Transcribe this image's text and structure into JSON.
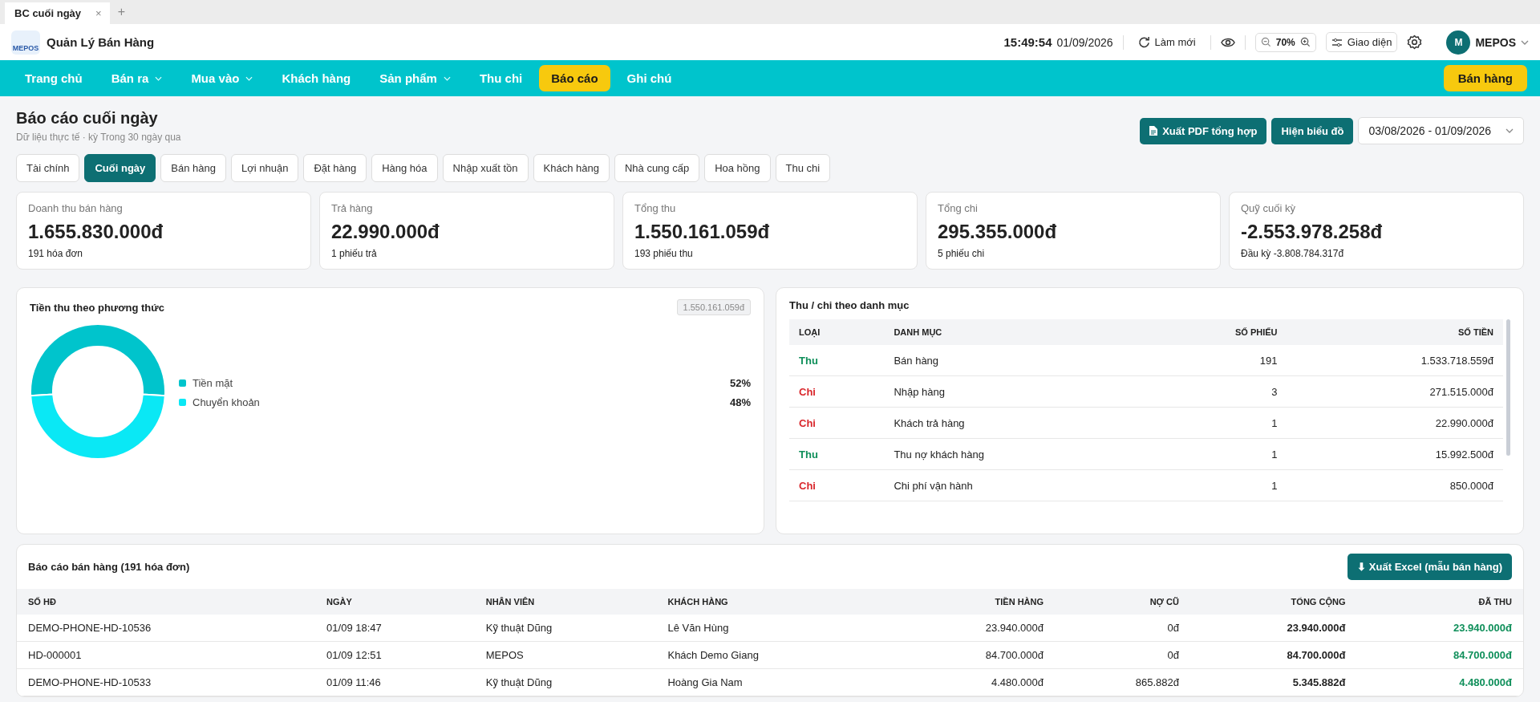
{
  "browser_tab": {
    "title": "BC cuối ngày",
    "close": "×",
    "new_tab": "+"
  },
  "header": {
    "app_name": "Quản Lý Bán Hàng",
    "logo_text": "MEPOS",
    "time": "15:49:54",
    "date": "01/09/2026",
    "refresh": "Làm mới",
    "zoom": "70%",
    "theme": "Giao diện",
    "avatar": "M",
    "user": "MEPOS"
  },
  "nav": {
    "items": [
      {
        "label": "Trang chủ",
        "has_menu": false,
        "selected": false
      },
      {
        "label": "Bán ra",
        "has_menu": true,
        "selected": false
      },
      {
        "label": "Mua vào",
        "has_menu": true,
        "selected": false
      },
      {
        "label": "Khách hàng",
        "has_menu": false,
        "selected": false
      },
      {
        "label": "Sản phẩm",
        "has_menu": true,
        "selected": false
      },
      {
        "label": "Thu chi",
        "has_menu": false,
        "selected": false
      },
      {
        "label": "Báo cáo",
        "has_menu": false,
        "selected": true
      },
      {
        "label": "Ghi chú",
        "has_menu": false,
        "selected": false
      }
    ],
    "sell_button": "Bán hàng"
  },
  "page": {
    "title": "Báo cáo cuối ngày",
    "subtitle": "Dữ liệu thực tế · kỳ Trong 30 ngày qua",
    "export_pdf": "Xuất PDF tổng hợp",
    "show_chart": "Hiện biểu đồ",
    "date_range": "03/08/2026 - 01/09/2026"
  },
  "report_tabs": [
    {
      "label": "Tài chính",
      "selected": false
    },
    {
      "label": "Cuối ngày",
      "selected": true
    },
    {
      "label": "Bán hàng",
      "selected": false
    },
    {
      "label": "Lợi nhuận",
      "selected": false
    },
    {
      "label": "Đặt hàng",
      "selected": false
    },
    {
      "label": "Hàng hóa",
      "selected": false
    },
    {
      "label": "Nhập xuất tồn",
      "selected": false
    },
    {
      "label": "Khách hàng",
      "selected": false
    },
    {
      "label": "Nhà cung cấp",
      "selected": false
    },
    {
      "label": "Hoa hồng",
      "selected": false
    },
    {
      "label": "Thu chi",
      "selected": false
    }
  ],
  "summary_cards": [
    {
      "label": "Doanh thu bán hàng",
      "value": "1.655.830.000đ",
      "note": "191 hóa đơn"
    },
    {
      "label": "Trả hàng",
      "value": "22.990.000đ",
      "note": "1 phiếu trả"
    },
    {
      "label": "Tổng thu",
      "value": "1.550.161.059đ",
      "note": "193 phiếu thu"
    },
    {
      "label": "Tổng chi",
      "value": "295.355.000đ",
      "note": "5 phiếu chi"
    },
    {
      "label": "Quỹ cuối kỳ",
      "value": "-2.553.978.258đ",
      "note": "Đầu kỳ -3.808.784.317đ"
    }
  ],
  "payment_panel": {
    "title": "Tiền thu theo phương thức",
    "total": "1.550.161.059đ",
    "legend": [
      {
        "percent": "52%",
        "color": "#00c4cc"
      },
      {
        "percent": "48%",
        "color": "#0ae8f5"
      }
    ],
    "chart_data": {
      "type": "donut",
      "categories": [
        "Tiền mặt",
        "Chuyển khoản"
      ],
      "values": [
        52,
        48
      ]
    }
  },
  "category_panel": {
    "title": "Thu / chi theo danh mục",
    "columns": [
      "LOẠI",
      "DANH MỤC",
      "SỐ PHIẾU",
      "SỐ TIỀN"
    ],
    "rows": [
      {
        "kind": "thu",
        "type": "Thu",
        "category": "Bán hàng",
        "count": "191",
        "amount": "1.533.718.559đ"
      },
      {
        "kind": "chi",
        "type": "Chi",
        "category": "Nhập hàng",
        "count": "3",
        "amount": "271.515.000đ"
      },
      {
        "kind": "chi",
        "type": "Chi",
        "category": "Khách trả hàng",
        "count": "1",
        "amount": "22.990.000đ"
      },
      {
        "kind": "thu",
        "type": "Thu",
        "category": "Thu nợ khách hàng",
        "count": "1",
        "amount": "15.992.500đ"
      },
      {
        "kind": "chi",
        "type": "Chi",
        "category": "Chi phí vận hành",
        "count": "1",
        "amount": "850.000đ"
      }
    ]
  },
  "sales_panel": {
    "title": "Báo cáo bán hàng (191 hóa đơn)",
    "export_excel": "⬇ Xuất Excel (mẫu bán hàng)",
    "columns": [
      "SỐ HĐ",
      "NGÀY",
      "NHÂN VIÊN",
      "KHÁCH HÀNG",
      "TIỀN HÀNG",
      "NỢ CŨ",
      "TỔNG CỘNG",
      "ĐÃ THU"
    ],
    "rows": [
      [
        "DEMO-PHONE-HD-10536",
        "01/09 18:47",
        "Kỹ thuật Dũng",
        "Lê Văn Hùng",
        "23.940.000đ",
        "0đ",
        "23.940.000đ",
        "23.940.000đ"
      ],
      [
        "HD-000001",
        "01/09 12:51",
        "MEPOS",
        "Khách Demo Giang",
        "84.700.000đ",
        "0đ",
        "84.700.000đ",
        "84.700.000đ"
      ],
      [
        "DEMO-PHONE-HD-10533",
        "01/09 11:46",
        "Kỹ thuật Dũng",
        "Hoàng Gia Nam",
        "4.480.000đ",
        "865.882đ",
        "5.345.882đ",
        "4.480.000đ"
      ]
    ]
  }
}
